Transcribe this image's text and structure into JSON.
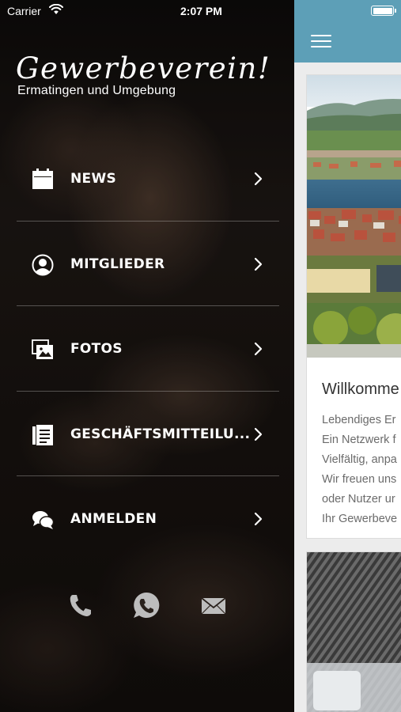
{
  "status_bar": {
    "carrier": "Carrier",
    "time": "2:07 PM"
  },
  "header": {
    "logo_title": "Gewerbeverein!",
    "logo_subtitle": "Ermatingen und Umgebung"
  },
  "menu": {
    "items": [
      {
        "label": "NEWS",
        "icon": "calendar-icon"
      },
      {
        "label": "MITGLIEDER",
        "icon": "user-icon"
      },
      {
        "label": "FOTOS",
        "icon": "photos-icon"
      },
      {
        "label": "GESCHÄFTSMITTEILU...",
        "icon": "document-icon"
      },
      {
        "label": "ANMELDEN",
        "icon": "chat-icon"
      }
    ]
  },
  "contact": {
    "icons": [
      "phone-icon",
      "whatsapp-icon",
      "mail-icon"
    ]
  },
  "content": {
    "card_title": "Willkomme",
    "card_lines": [
      "Lebendiges Er",
      "Ein Netzwerk f",
      "Vielfältig, anpa",
      "Wir freuen uns",
      "oder Nutzer ur",
      "Ihr Gewerbeve"
    ]
  },
  "colors": {
    "accent": "#5d9fb7",
    "drawer_text": "#ffffff",
    "card_text": "#6b6b6b"
  }
}
